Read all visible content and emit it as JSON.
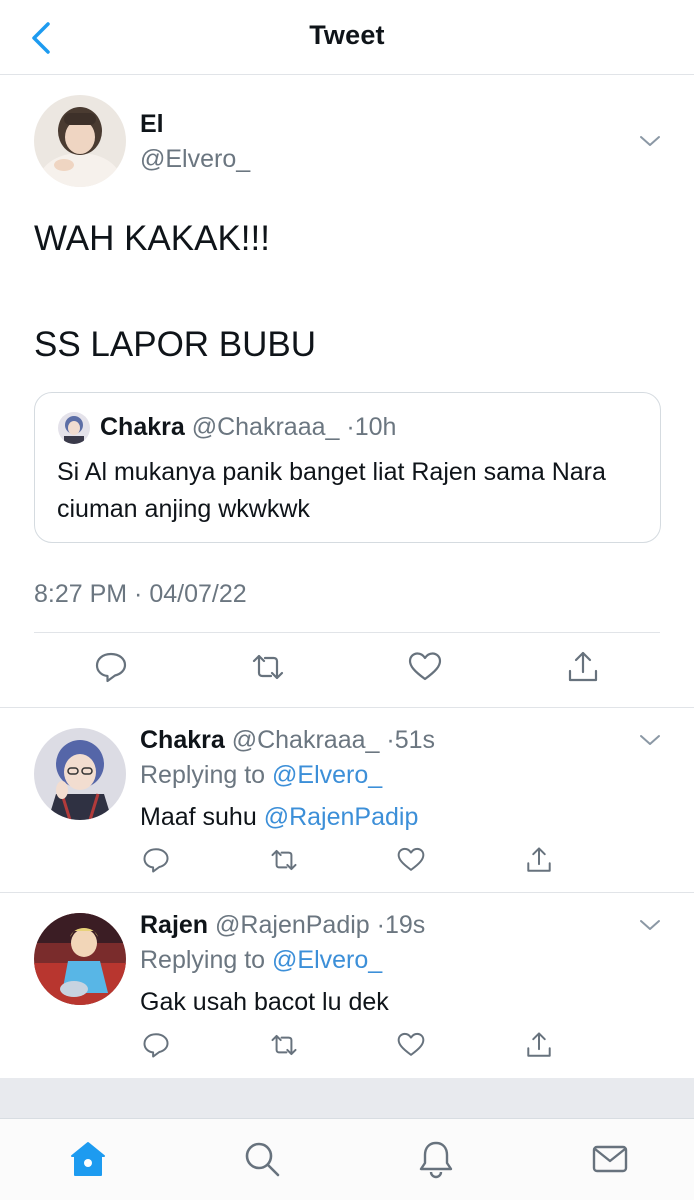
{
  "header": {
    "title": "Tweet",
    "back_icon": "chevron-left-icon"
  },
  "main_tweet": {
    "name": "El",
    "handle": "@Elvero_",
    "text_line1": "WAH KAKAK!!!",
    "text_line2": "SS LAPOR BUBU",
    "quote": {
      "name": "Chakra",
      "handle": "@Chakraaa_",
      "dot": "·",
      "time": "10h",
      "text": "Si Al mukanya panik banget liat Rajen sama Nara ciuman anjing wkwkwk"
    },
    "timestamp": "8:27 PM · 04/07/22"
  },
  "replies": [
    {
      "name": "Chakra",
      "handle": "@Chakraaa_",
      "dot": "·",
      "time": "51s",
      "replying_label": "Replying to",
      "replying_to": "@Elvero_",
      "text_prefix": "Maaf suhu",
      "mention": "@RajenPadip"
    },
    {
      "name": "Rajen",
      "handle": "@RajenPadip",
      "dot": "·",
      "time": "19s",
      "replying_label": "Replying to",
      "replying_to": "@Elvero_",
      "text": "Gak usah bacot lu dek"
    }
  ],
  "actions": [
    "reply-icon",
    "retweet-icon",
    "like-icon",
    "share-icon"
  ],
  "bottom_nav": [
    "home-icon",
    "search-icon",
    "notifications-icon",
    "messages-icon"
  ],
  "colors": {
    "accent": "#1d9bf0",
    "link": "#3c8fd8",
    "secondary_text": "#6b7680",
    "icon_grey": "#67727d",
    "divider": "#e1e4e8"
  }
}
